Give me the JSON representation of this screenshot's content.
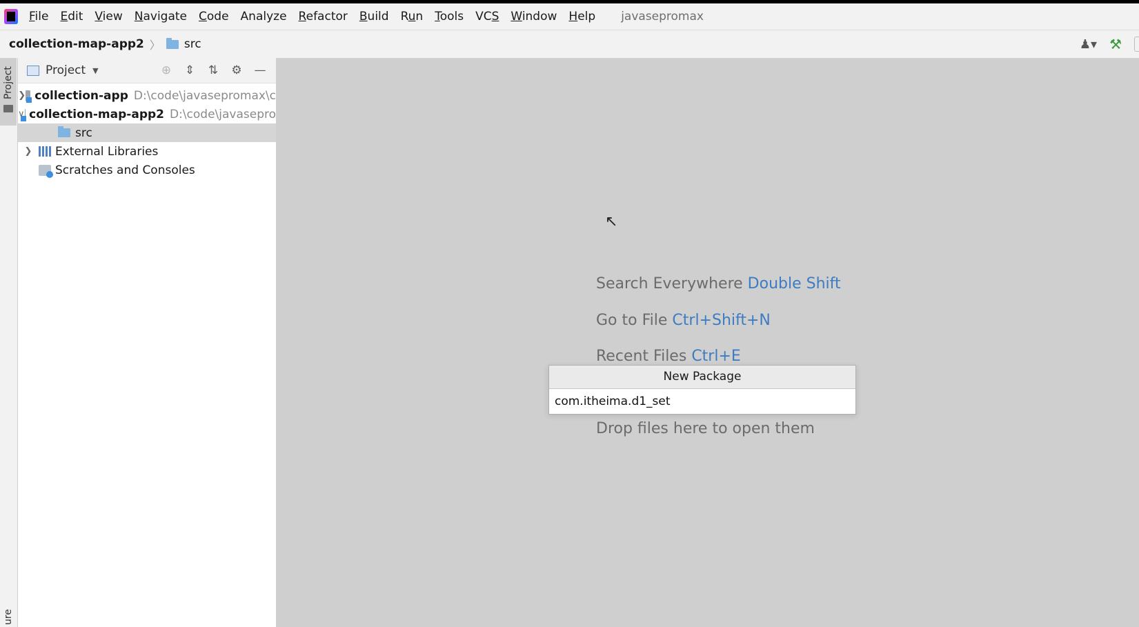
{
  "menubar": {
    "items": [
      {
        "label": "File",
        "mn": "F"
      },
      {
        "label": "Edit",
        "mn": "E"
      },
      {
        "label": "View",
        "mn": "V"
      },
      {
        "label": "Navigate",
        "mn": "N"
      },
      {
        "label": "Code",
        "mn": "C"
      },
      {
        "label": "Analyze",
        "mn": ""
      },
      {
        "label": "Refactor",
        "mn": "R"
      },
      {
        "label": "Build",
        "mn": "B"
      },
      {
        "label": "Run",
        "mn": "u"
      },
      {
        "label": "Tools",
        "mn": "T"
      },
      {
        "label": "VCS",
        "mn": "S"
      },
      {
        "label": "Window",
        "mn": "W"
      },
      {
        "label": "Help",
        "mn": "H"
      }
    ],
    "project_name": "javasepromax"
  },
  "navbar": {
    "root": "collection-map-app2",
    "separator": "〉",
    "folder": "src"
  },
  "toolstrip": {
    "project_tab": "Project",
    "bottom_tab": "ure"
  },
  "project_panel": {
    "title": "Project",
    "tree": [
      {
        "name": "collection-app",
        "path": "D:\\code\\javasepromax\\c",
        "expanded": false,
        "selected": false
      },
      {
        "name": "collection-map-app2",
        "path": "D:\\code\\javasepro",
        "expanded": true,
        "selected": false
      },
      {
        "name": "src",
        "path": "",
        "expanded": false,
        "selected": true
      },
      {
        "name": "External Libraries",
        "path": "",
        "expanded": false,
        "selected": false
      },
      {
        "name": "Scratches and Consoles",
        "path": "",
        "expanded": false,
        "selected": false
      }
    ]
  },
  "editor": {
    "hints": [
      {
        "text": "Search Everywhere",
        "key": "Double Shift"
      },
      {
        "text": "Go to File",
        "key": "Ctrl+Shift+N"
      },
      {
        "text": "Recent Files",
        "key": "Ctrl+E"
      },
      {
        "text": "Drop files here to open them",
        "key": ""
      }
    ]
  },
  "popup": {
    "title": "New Package",
    "value": "com.itheima.d1_set"
  },
  "colors": {
    "accent": "#3d7cc2",
    "editor_bg": "#cfcfcf",
    "selection": "#d5d5d5"
  }
}
